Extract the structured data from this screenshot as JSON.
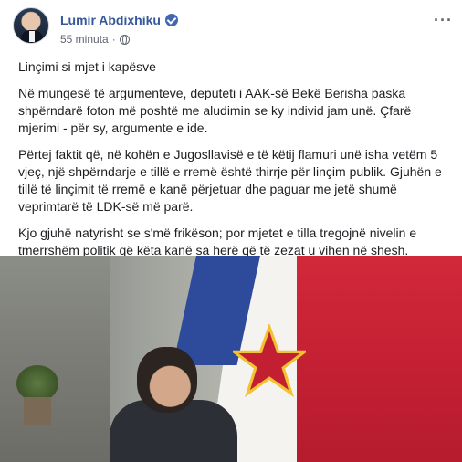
{
  "post": {
    "author": "Lumir Abdixhiku",
    "timestamp": "55 minuta",
    "separator": "·",
    "icons": {
      "verified": "verified-badge-icon",
      "privacy": "globe-icon",
      "more": "more-options-icon"
    },
    "more_label": "···",
    "paragraphs": [
      "Linçimi si mjet i kapësve",
      "Në mungesë të argumenteve, deputeti i AAK-së Bekë Berisha paska shpërndarë foton më poshtë me aludimin se ky individ jam unë. Çfarë mjerimi - për sy, argumente e ide.",
      "Përtej faktit që, në kohën e Jugosllavisë e të këtij flamuri unë isha vetëm 5 vjeç, një shpërndarje e tillë e rremë është thirrje për linçim publik. Gjuhën e tillë të linçimit të rremë e kanë përjetuar dhe paguar me jetë shumë veprimtarë të LDK-së më parë.",
      "Kjo gjuhë natyrisht se s'më frikëson; por mjetet e tilla tregojnë nivelin e tmerrshëm politik që këta kanë sa herë që të zezat u vihen në shesh."
    ]
  },
  "colors": {
    "author": "#365899",
    "text": "#1c1e21",
    "meta": "#616770",
    "flag_blue": "#2e4a9b",
    "flag_red": "#c21f32"
  }
}
